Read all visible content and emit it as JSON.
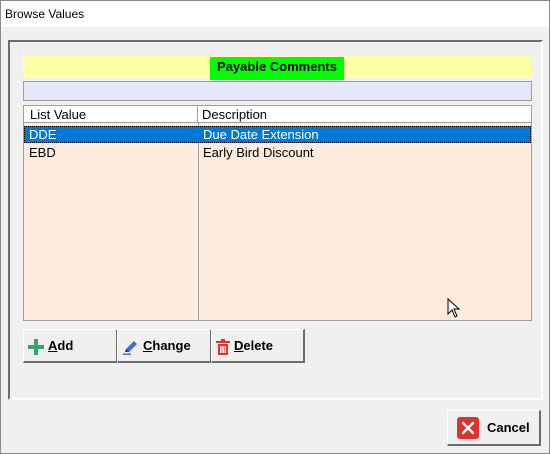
{
  "window": {
    "title": "Browse Values"
  },
  "header": {
    "title": "Payable Comments"
  },
  "list": {
    "columns": [
      "List Value",
      "Description"
    ],
    "rows": [
      {
        "value": "DDE",
        "description": "Due Date Extension",
        "selected": true
      },
      {
        "value": "EBD",
        "description": "Early Bird Discount",
        "selected": false
      }
    ]
  },
  "buttons": {
    "add": {
      "label": "Add",
      "icon": "plus-icon"
    },
    "change": {
      "label": "Change",
      "icon": "pencil-icon"
    },
    "delete": {
      "label": "Delete",
      "icon": "trash-icon"
    },
    "cancel": {
      "label": "Cancel",
      "icon": "close-icon"
    }
  },
  "colors": {
    "header_band": "#ffffa5",
    "header_title_bg": "#00ff00",
    "list_bg": "#fdebde",
    "selection": "#0078d7",
    "add_icon": "#3aa56b",
    "delete_icon": "#d9352b",
    "cancel_icon": "#e0322e"
  }
}
